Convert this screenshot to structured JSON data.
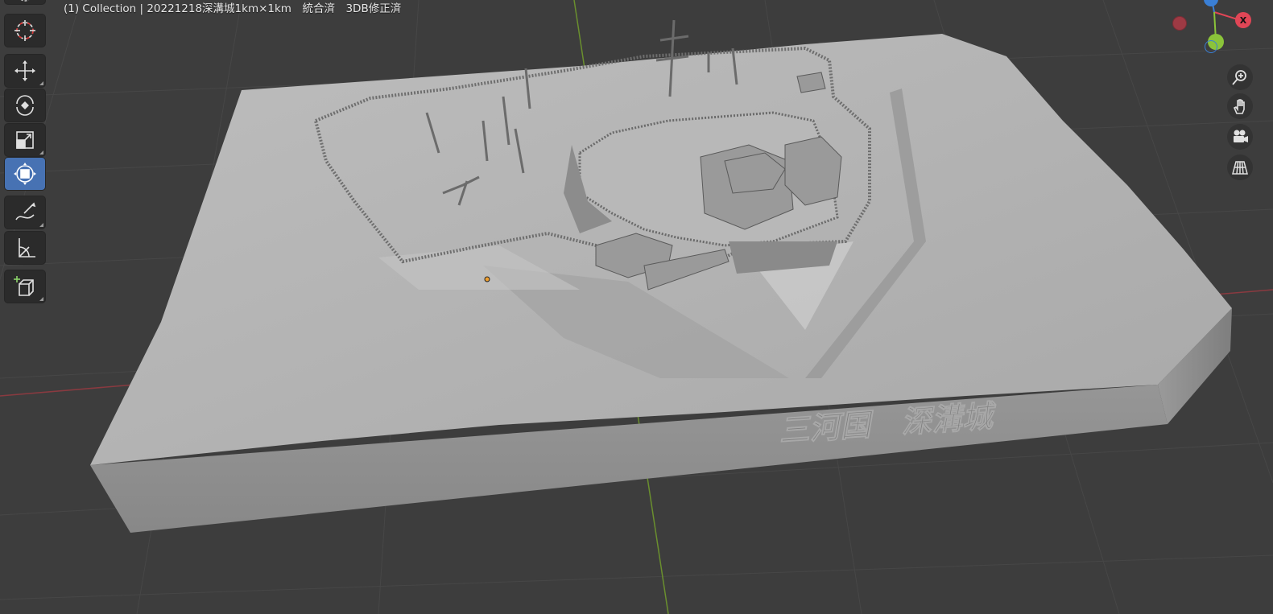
{
  "header": {
    "title": "(1) Collection | 20221218深溝城1km×1km　統合済　3DB修正済"
  },
  "model": {
    "engraving": "三河国　深溝城"
  },
  "toolbar": {
    "tools": [
      {
        "name": "cursor",
        "icon": "cursor-icon",
        "active": false
      },
      {
        "name": "move",
        "icon": "move-icon",
        "active": false
      },
      {
        "name": "rotate",
        "icon": "rotate-icon",
        "active": false
      },
      {
        "name": "scale",
        "icon": "scale-icon",
        "active": false
      },
      {
        "name": "transform",
        "icon": "transform-icon",
        "active": true
      },
      {
        "name": "annotate",
        "icon": "annotate-icon",
        "active": false
      },
      {
        "name": "measure",
        "icon": "measure-icon",
        "active": false
      },
      {
        "name": "add-cube",
        "icon": "add-cube-icon",
        "active": false
      }
    ]
  },
  "gizmo": {
    "x_label": "X",
    "colors": {
      "x": "#e04656",
      "y": "#8bc43a",
      "z": "#3a7fd5",
      "neg_x": "#9e3a44",
      "neg_y": "#5c8a2e"
    }
  },
  "navigation": {
    "buttons": [
      "zoom-icon",
      "hand-pan-icon",
      "camera-icon",
      "grid-icon"
    ]
  },
  "colors": {
    "viewport_bg": "#3d3d3d",
    "grid_line": "#474747",
    "active_tool": "#4772b3",
    "model_top": "#b0b0b0",
    "model_front": "#8e8e8e"
  }
}
